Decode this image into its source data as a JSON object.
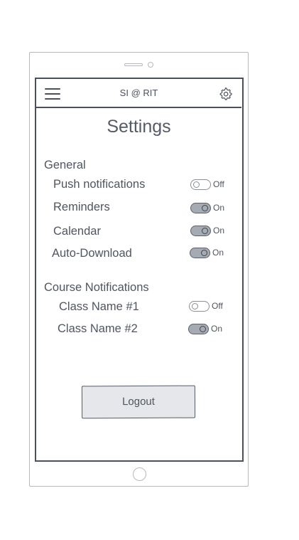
{
  "header": {
    "title": "SI @ RIT",
    "menu_icon": "hamburger-menu-icon",
    "settings_icon": "gear-icon"
  },
  "page": {
    "title": "Settings"
  },
  "general": {
    "heading": "General",
    "items": [
      {
        "label": "Push notifications",
        "state": "Off",
        "on": false
      },
      {
        "label": "Reminders",
        "state": "On",
        "on": true
      },
      {
        "label": "Calendar",
        "state": "On",
        "on": true
      },
      {
        "label": "Auto-Download",
        "state": "On",
        "on": true
      }
    ]
  },
  "courses": {
    "heading": "Course Notifications",
    "items": [
      {
        "label": "Class Name #1",
        "state": "Off",
        "on": false
      },
      {
        "label": "Class Name #2",
        "state": "On",
        "on": true
      }
    ]
  },
  "logout": {
    "label": "Logout"
  },
  "colors": {
    "ink": "#4a505c",
    "frame": "#b4b8c0",
    "toggle_on_fill": "#a6aab2",
    "button_fill": "#e6e7ea"
  }
}
